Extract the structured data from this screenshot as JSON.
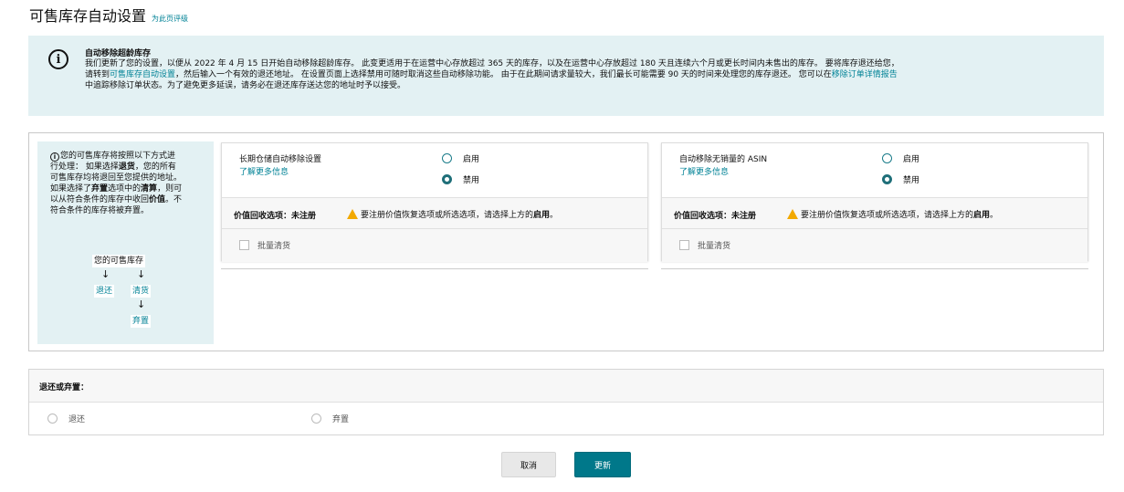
{
  "header": {
    "title": "可售库存自动设置",
    "rate_link": "为此页评级"
  },
  "notice": {
    "icon": "info-icon",
    "title": "自动移除超龄库存",
    "line1": "我们更新了您的设置，以便从 2022 年 4 月 15 日开始自动移除超龄库存。 此变更适用于在运营中心存放超过 365 天的库存，以及在运营中心存放超过 180 天且连续六个月或更长时间内未售出的库存。 要将库存退还给您，",
    "line2_prefix": "请转到",
    "line2_link": "可售库存自动设置",
    "line2_mid": "，然后输入一个有效的退还地址。 在设置页面上选择禁用可随时取消这些自动移除功能。 由于在此期间请求量较大，我们最长可能需要 90 天的时间来处理您的库存退还。 您可以在",
    "line2_link2": "移除订单详情报告",
    "line3": "中追踪移除订单状态。为了避免更多延误，请务必在退还库存送达您的地址时予以接受。"
  },
  "explain": {
    "t1": "您的可售库存将按照以下方式进",
    "t2": "行处理： 如果选择",
    "t2b": "退货",
    "t2c": "，您的所有",
    "t3": "可售库存均将退回至您提供的地址。",
    "t4a": "如果选择了",
    "t4b": "弃置",
    "t4c": "选项中的",
    "t4d": "清算",
    "t4e": "，则可",
    "t5a": "以从符合条件的库存中收回",
    "t5b": "价值",
    "t5c": "。不",
    "t6": "符合条件的库存将被弃置。",
    "flow_top": "您的可售库存",
    "flow_return": "退还",
    "flow_liquidate": "清货",
    "flow_dispose": "弃置"
  },
  "panels": [
    {
      "label": "长期仓储自动移除设置",
      "link": "了解更多信息",
      "enable": "启用",
      "disable": "禁用",
      "selected": "disable",
      "value_label": "价值回收选项：未注册",
      "warn_text": "要注册价值恢复选项或所选选项，请选择上方的",
      "warn_bold": "启用",
      "warn_end": "。",
      "bulk": "批量清货"
    },
    {
      "label": "自动移除无销量的 ASIN",
      "link": "了解更多信息",
      "enable": "启用",
      "disable": "禁用",
      "selected": "disable",
      "value_label": "价值回收选项：未注册",
      "warn_text": "要注册价值恢复选项或所选选项，请选择上方的",
      "warn_bold": "启用",
      "warn_end": "。",
      "bulk": "批量清货"
    }
  ],
  "return_section": {
    "title": "退还或弃置：",
    "option_return": "退还",
    "option_dispose": "弃置"
  },
  "buttons": {
    "cancel": "取消",
    "update": "更新"
  },
  "colors": {
    "link": "#008296",
    "notice_bg": "#e3f1f3",
    "primary": "#00788a",
    "warning": "#f2a900"
  }
}
